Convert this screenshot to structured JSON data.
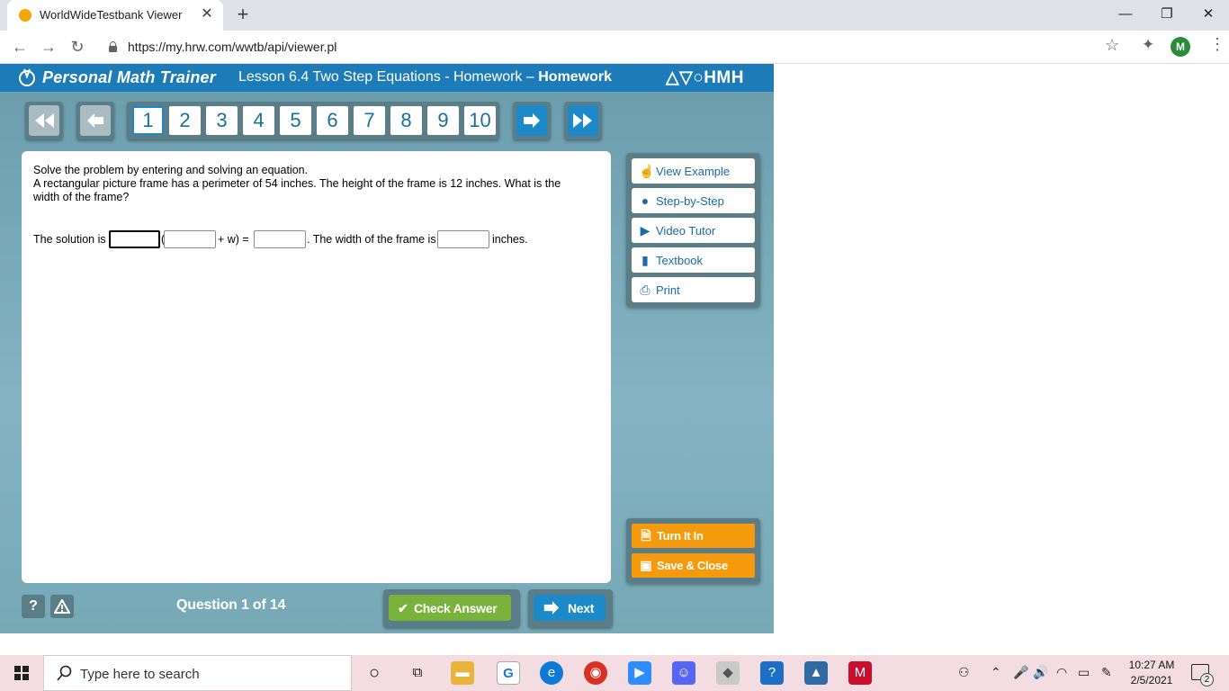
{
  "browser": {
    "tab_title": "WorldWideTestbank Viewer",
    "url": "https://my.hrw.com/wwtb/api/viewer.pl",
    "profile_initial": "M"
  },
  "app": {
    "brand": "Personal Math Trainer",
    "lesson_title": "Lesson 6.4 Two Step Equations - Homework",
    "lesson_suffix": "Homework",
    "publisher": "HMH",
    "question_numbers": [
      "1",
      "2",
      "3",
      "4",
      "5",
      "6",
      "7",
      "8",
      "9",
      "10"
    ],
    "current_question": 1,
    "question": {
      "instruction": "Solve the problem by entering and solving an equation.",
      "problem": "A rectangular picture frame has a perimeter of 54 inches. The height of the frame is 12 inches. What is the width of the frame?",
      "solution_prefix": "The solution is",
      "paren_open": "(",
      "plus_w": "+ w) =",
      "width_prefix": ". The width of the frame is",
      "units": "inches."
    },
    "side_buttons": [
      "View Example",
      "Step-by-Step",
      "Video Tutor",
      "Textbook",
      "Print"
    ],
    "turn_in": "Turn It In",
    "save_close": "Save & Close",
    "help": "?",
    "alert": "!",
    "question_counter": "Question 1 of 14",
    "check_answer": "Check Answer",
    "next": "Next",
    "colors": {
      "header": "#1d7cb8",
      "check": "#7ab33c",
      "orange": "#f59a0c",
      "blue": "#1c8ac8"
    }
  },
  "taskbar": {
    "search_placeholder": "Type here to search",
    "time": "10:27 AM",
    "date": "2/5/2021",
    "notification_count": "2"
  }
}
